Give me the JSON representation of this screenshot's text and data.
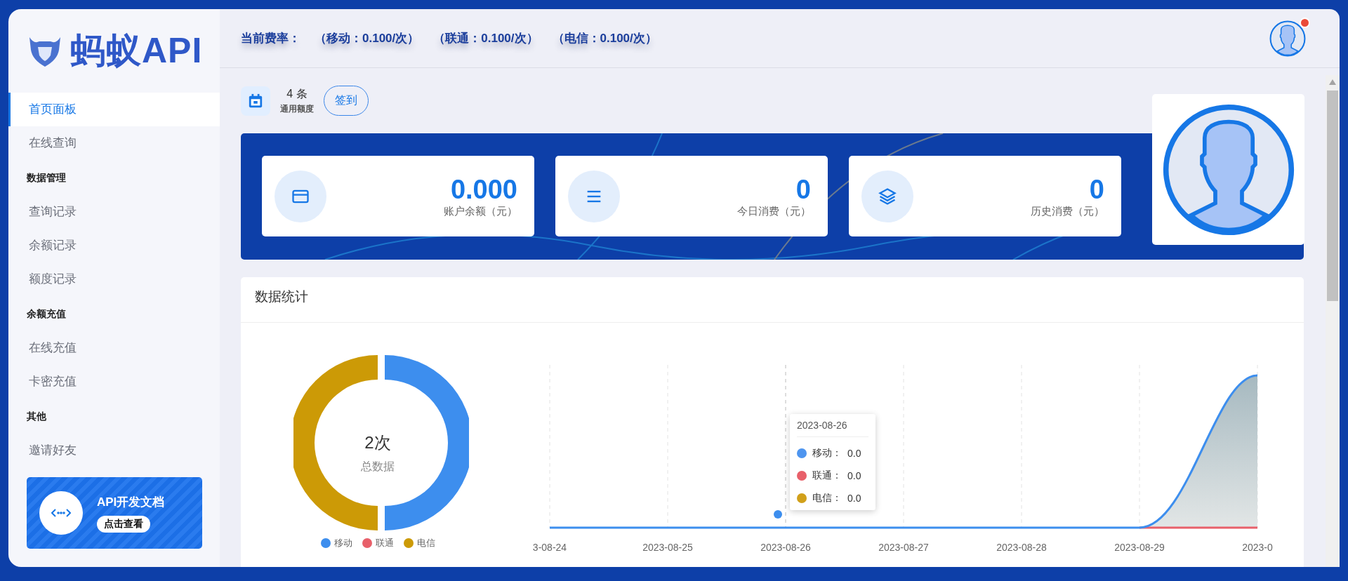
{
  "sidebar": {
    "logo": "蚂蚁API",
    "items": [
      {
        "kind": "link",
        "label": "首页面板",
        "selected": true
      },
      {
        "kind": "link",
        "label": "在线查询",
        "selected": false
      },
      {
        "kind": "section",
        "label": "数据管理"
      },
      {
        "kind": "link",
        "label": "查询记录",
        "selected": false
      },
      {
        "kind": "link",
        "label": "余额记录",
        "selected": false
      },
      {
        "kind": "link",
        "label": "额度记录",
        "selected": false
      },
      {
        "kind": "section",
        "label": "余额充值"
      },
      {
        "kind": "link",
        "label": "在线充值",
        "selected": false
      },
      {
        "kind": "link",
        "label": "卡密充值",
        "selected": false
      },
      {
        "kind": "section",
        "label": "其他"
      },
      {
        "kind": "link",
        "label": "邀请好友",
        "selected": false
      }
    ],
    "doc_card": {
      "title": "API开发文档",
      "button": "点击查看"
    }
  },
  "header": {
    "rate_label": "当前费率：",
    "rates": [
      "（移动：0.100/次）",
      "（联通：0.100/次）",
      "（电信：0.100/次）"
    ],
    "notification": true
  },
  "checkin": {
    "count": "4 条",
    "caption": "通用额度",
    "button": "签到"
  },
  "stat_cards": [
    {
      "kind": "card",
      "value": "0.000",
      "label": "账户余额（元）"
    },
    {
      "kind": "list",
      "value": "0",
      "label": "今日消费（元）"
    },
    {
      "kind": "layers",
      "value": "0",
      "label": "历史消费（元）"
    }
  ],
  "stats": {
    "title": "数据统计",
    "donut": {
      "total": "2次",
      "caption": "总数据"
    },
    "legend": [
      {
        "name": "移动",
        "color": "#3d8eee"
      },
      {
        "name": "联通",
        "color": "#e8606a"
      },
      {
        "name": "电信",
        "color": "#cc9a06"
      }
    ],
    "x_labels": [
      "3-08-24",
      "2023-08-25",
      "2023-08-26",
      "2023-08-27",
      "2023-08-28",
      "2023-08-29",
      "2023-0"
    ],
    "tooltip": {
      "date": "2023-08-26",
      "rows": [
        {
          "name": "移动：",
          "value": "0.0",
          "color": "#4e95ef"
        },
        {
          "name": "联通：",
          "value": "0.0",
          "color": "#e8606a"
        },
        {
          "name": "电信：",
          "value": "0.0",
          "color": "#d1a01a"
        }
      ]
    }
  }
}
